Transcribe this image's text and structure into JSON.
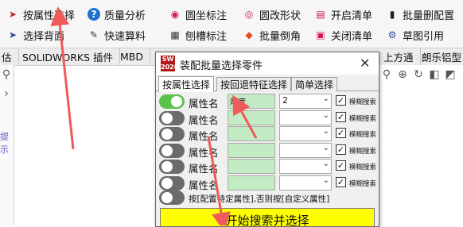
{
  "ribbon": {
    "row1": [
      {
        "icon": "cursor-arrow-icon",
        "glyph": "➤",
        "color": "#c0262d",
        "label": "按属性选择"
      },
      {
        "icon": "help-circle-icon",
        "glyph": "?",
        "color": "#1e6fd0",
        "label": "质量分析"
      },
      {
        "icon": "circle-mark-icon",
        "glyph": "◉",
        "color": "#d4145a",
        "label": "圆坐标注"
      },
      {
        "icon": "circle-modify-icon",
        "glyph": "◎",
        "color": "#d4145a",
        "label": "圆改形状"
      },
      {
        "icon": "open-list-icon",
        "glyph": "▤",
        "color": "#d4145a",
        "label": "开启清单"
      },
      {
        "icon": "trash-icon",
        "glyph": "🗑",
        "color": "#222222",
        "label": "批量删配置"
      }
    ],
    "row2": [
      {
        "icon": "cursor-arrow-icon",
        "glyph": "➤",
        "color": "#2b4f9c",
        "label": "选择背面"
      },
      {
        "icon": "edit-pencil-icon",
        "glyph": "✎",
        "color": "#333333",
        "label": "快速算料"
      },
      {
        "icon": "grid-icon",
        "glyph": "▦",
        "color": "#333333",
        "label": "刨槽标注"
      },
      {
        "icon": "chamfer-icon",
        "glyph": "◆",
        "color": "#e24d1b",
        "label": "批量倒角"
      },
      {
        "icon": "close-list-icon",
        "glyph": "▣",
        "color": "#d4145a",
        "label": "关闭清单"
      },
      {
        "icon": "drawing-reference-icon",
        "glyph": "⚙",
        "color": "#2b4f9c",
        "label": "草图引用"
      }
    ]
  },
  "tabs": [
    "估",
    "SOLIDWORKS 插件",
    "MBD",
    "上方通",
    "朗乐铝型"
  ],
  "side_text": "提示",
  "dialog": {
    "title": "装配批量选择零件",
    "logo": "SW 2020",
    "close": "✕",
    "tabs": [
      "按属性选择",
      "按回退特征选择",
      "简单选择"
    ],
    "active_tab": "按属性选择",
    "rows": [
      {
        "enabled": true,
        "label": "属性名",
        "name": "厚度",
        "value": "2",
        "fuzzy": true,
        "fuzzy_label": "模糊搜索"
      },
      {
        "enabled": false,
        "label": "属性名",
        "name": "",
        "value": "",
        "fuzzy": true,
        "fuzzy_label": "模糊搜索"
      },
      {
        "enabled": false,
        "label": "属性名",
        "name": "",
        "value": "",
        "fuzzy": true,
        "fuzzy_label": "模糊搜索"
      },
      {
        "enabled": false,
        "label": "属性名",
        "name": "",
        "value": "",
        "fuzzy": true,
        "fuzzy_label": "模糊搜索"
      },
      {
        "enabled": false,
        "label": "属性名",
        "name": "",
        "value": "",
        "fuzzy": true,
        "fuzzy_label": "模糊搜索"
      },
      {
        "enabled": false,
        "label": "属性名",
        "name": "",
        "value": "",
        "fuzzy": true,
        "fuzzy_label": "模糊搜索"
      }
    ],
    "config_label": "按[配置特定属性],否则按[自定义属性]",
    "config_enabled": false,
    "start_button": "开始搜索并选择"
  },
  "colors": {
    "toggle_on": "#5cc14b",
    "toggle_off": "#6b6b6b",
    "field_green": "#c4ecc4",
    "button_yellow": "#ffff00",
    "arrow_red": "#ef5a5a"
  }
}
